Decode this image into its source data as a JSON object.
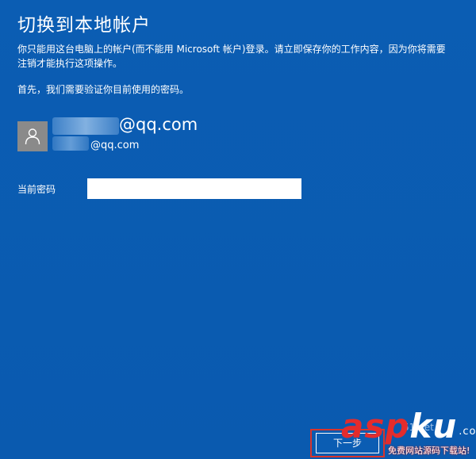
{
  "dialog": {
    "title": "切换到本地帐户",
    "description": "你只能用这台电脑上的帐户(而不能用 Microsoft 帐户)登录。请立即保存你的工作内容，因为你将需要注销才能执行这项操作。",
    "verify_text": "首先，我们需要验证你目前使用的密码。"
  },
  "account": {
    "email_display": "@qq.com",
    "email_sub": "@qq.com",
    "avatar_icon": "user-icon"
  },
  "password": {
    "label": "当前密码",
    "value": ""
  },
  "buttons": {
    "next_label": "下一步"
  },
  "watermark": {
    "faint_text": "51.net",
    "logo_asp": "asp",
    "logo_ku": "ku",
    "logo_net": ".com",
    "slogan": "免费网站源码下载站!"
  },
  "colors": {
    "background": "#0a5cb1",
    "text": "#ffffff",
    "avatar_bg": "#8a8a8a",
    "highlight_border": "#d8342c",
    "watermark_red": "#e32c2c"
  }
}
